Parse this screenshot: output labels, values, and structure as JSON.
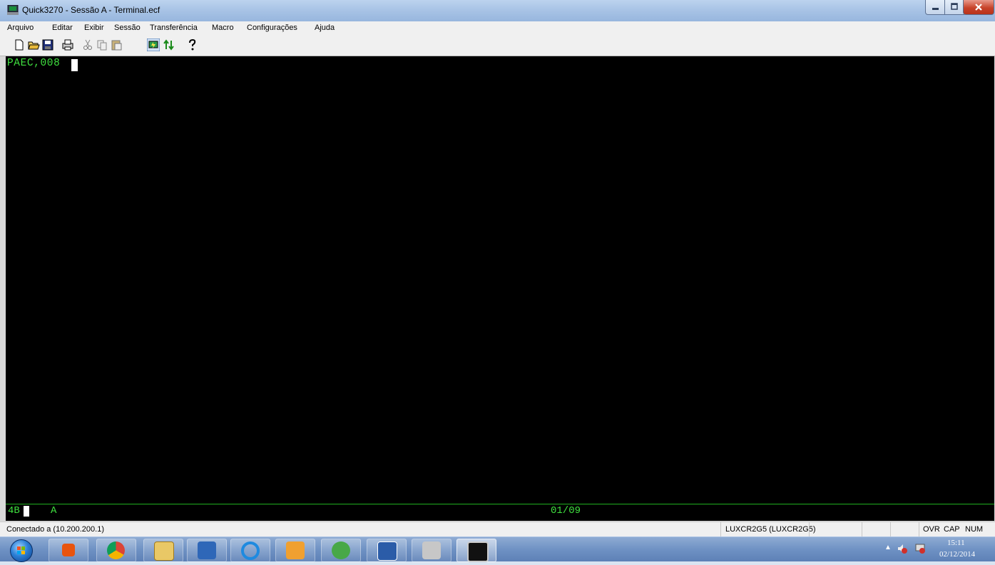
{
  "window": {
    "title": "Quick3270 - Sessão A - Terminal.ecf"
  },
  "menu": [
    "Arquivo",
    "Editar",
    "Exibir",
    "Sessão",
    "Transferência",
    "Macro",
    "Configurações",
    "Ajuda"
  ],
  "toolbar": {
    "icons": [
      "new-document-icon",
      "open-folder-icon",
      "save-icon",
      "print-icon",
      "cut-icon",
      "copy-icon",
      "paste-icon",
      "connect-icon",
      "transfer-icon",
      "help-icon"
    ]
  },
  "terminal": {
    "line1": "PAEC,008",
    "oia_left": "4B",
    "oia_session": "A",
    "oia_cursor_pos": "01/09",
    "text_color": "#3fe03f"
  },
  "statusbar": {
    "connection": "Conectado a  (10.200.200.1)",
    "host": "LUXCR2G5 (LUXCR2G5)",
    "ovr": "OVR",
    "cap": "CAP",
    "num": "NUM"
  },
  "taskbar": {
    "apps": [
      "start-orb",
      "office-icon",
      "chrome-icon",
      "explorer-icon",
      "app-check-icon",
      "ie-icon",
      "outlook-icon",
      "messenger-icon",
      "word-icon",
      "printer-app-icon",
      "quick3270-icon"
    ],
    "clock_time": "15:11",
    "clock_date": "02/12/2014"
  }
}
